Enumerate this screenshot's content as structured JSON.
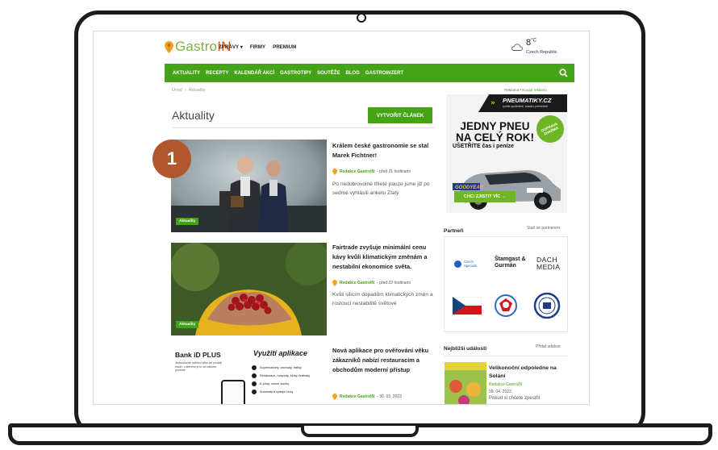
{
  "header": {
    "logo_gastro": "Gastro",
    "logo_in": "IN",
    "nav": [
      "ZPRÁVY ▾",
      "FIRMY",
      "PREMIUM"
    ],
    "weather_temp": "8",
    "weather_unit": "°C",
    "weather_country": "Czech Republic"
  },
  "main_nav": [
    "AKTUALITY",
    "RECEPTY",
    "KALENDÁŘ AKCÍ",
    "GASTROTIPY",
    "SOUTĚŽE",
    "BLOG",
    "GASTROINZERT"
  ],
  "breadcrumb": {
    "home": "Úvod",
    "separator": "›",
    "current": "Aktuality"
  },
  "page_title": "Aktuality",
  "create_button": "VYTVOŘIT ČLÁNEK",
  "step_badge": "1",
  "articles": [
    {
      "title": "Králem české gastronomie se stal Marek Fichtner!",
      "author": "Redakce GastroIN",
      "time": " - před 21 hodinami",
      "excerpt": "Po nedobrovolné třileté pauze jsme již po sedmé vyhlásili anketu Zlatý",
      "tag": "Aktuality"
    },
    {
      "title": "Fairtrade zvyšuje minimální cenu kávy kvůli klimatickým změnám a nestabilní ekonomice světa.",
      "author": "Redakce GastroIN",
      "time": " - před 22 hodinami",
      "excerpt": "Kvůli silicím dopadům klimatických změn a rostoucí nestabilitě světové",
      "tag": "Aktuality"
    },
    {
      "title": "Nová aplikace pro ověřování věku zákazníků nabízí restauracím a obchodům moderní přístup",
      "author": "Redakce GastroIN",
      "time": " - 30. 03. 2023"
    }
  ],
  "bank_ad": {
    "title": "Bank iD PLUS",
    "subtitle": "Jednoduché ověření věku při prodeji zboží, u kterého je to ze zákona povinné",
    "heading": "Využití aplikace",
    "items": [
      "Supermarkety, obchody, trafiky",
      "Restaurace, hospody, kluby, festivaly",
      "E-shop, online služby",
      "Automaty a výdejní boxy"
    ]
  },
  "sidebar": {
    "ad_label": "Reklama",
    "ad_buy": "Koupit reklamu",
    "promo": {
      "brand": "PNEUMATIKY.CZ",
      "brand_sub": "rychle spolehlivě, snadno přehledně",
      "headline": "JEDNY PNEU NA CELÝ ROK!",
      "sub": "UŠETŘÍTE čas i peníze",
      "free_badge": "DOPRAVA ZDARMA",
      "tire_brand": "GOODYEAR",
      "cta": "CHCI ZJISTIT VÍC →"
    },
    "partners_title": "Partneři",
    "partners_link": "Staň se partnerem",
    "partners": [
      "Czech Specials",
      "Štamgast & Gurmán",
      "DACH MEDIA"
    ],
    "events_title": "Nejbližší události",
    "events_link": "Přidat událost",
    "event": {
      "title": "Velikonoční odpoledne na Solání",
      "author": "Redakce GastroIN",
      "date": "09. 04. 2023",
      "excerpt": "Pokud si chcete zpestřit"
    }
  }
}
